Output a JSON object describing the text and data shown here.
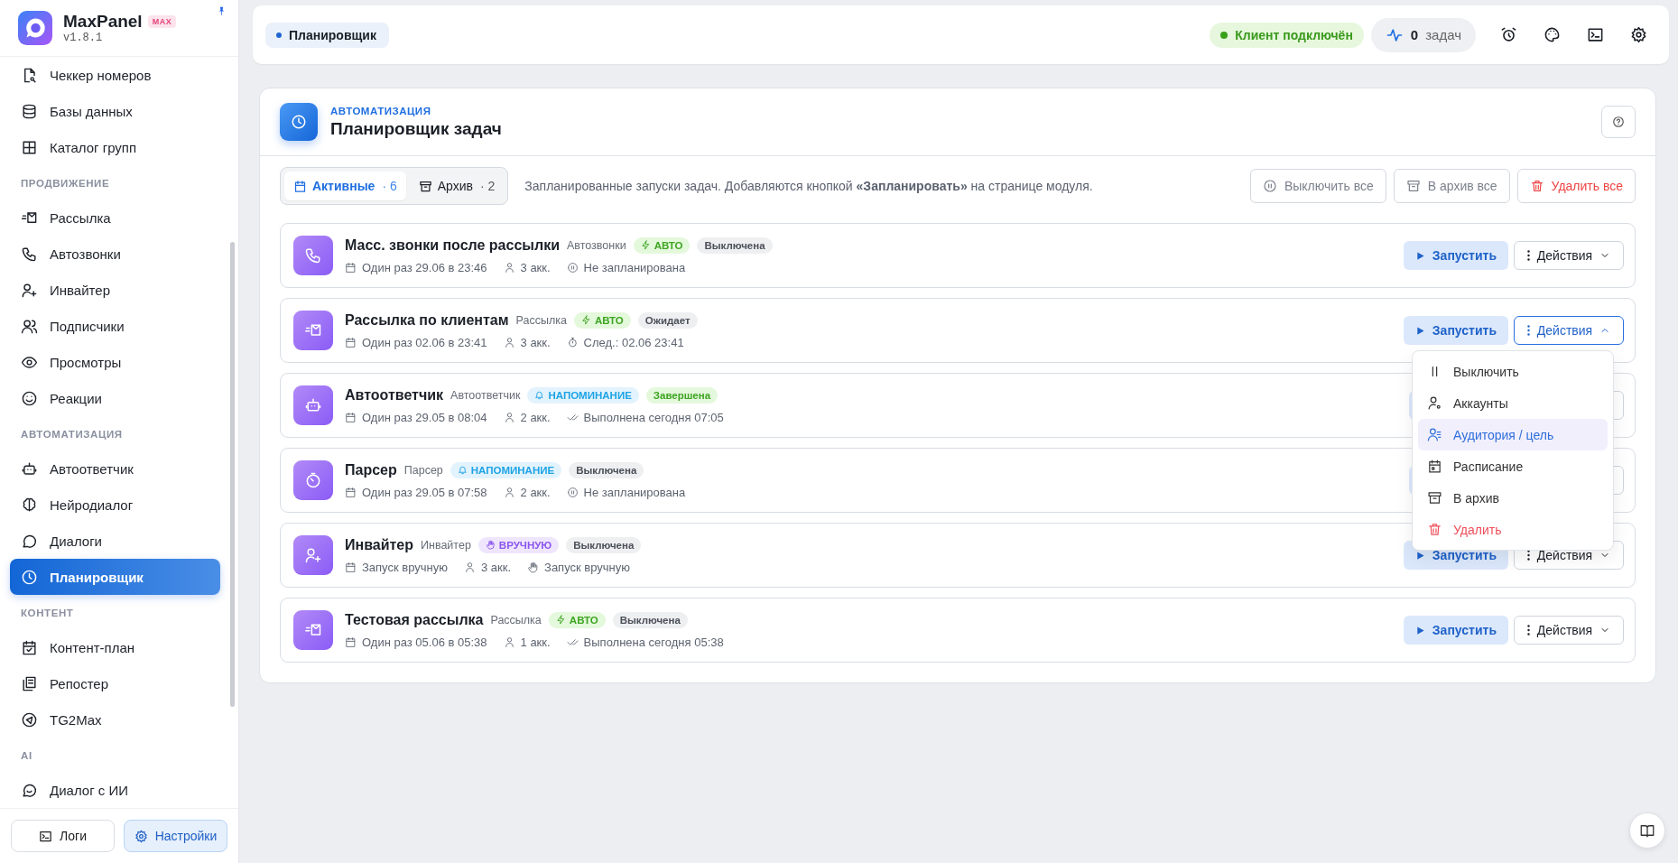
{
  "sidebar": {
    "logo": {
      "name": "MaxPanel",
      "badge": "MAX",
      "version": "v1.8.1"
    },
    "sections": [
      {
        "items": [
          {
            "label": "Чеккер номеров",
            "kind": "checker",
            "selected": false
          },
          {
            "label": "Базы данных",
            "kind": "database",
            "selected": false
          },
          {
            "label": "Каталог групп",
            "kind": "catalog",
            "selected": false
          }
        ]
      },
      {
        "title": "ПРОДВИЖЕНИЕ",
        "items": [
          {
            "label": "Рассылка",
            "kind": "mailing",
            "selected": false
          },
          {
            "label": "Автозвонки",
            "kind": "calls",
            "selected": false
          },
          {
            "label": "Инвайтер",
            "kind": "inviter",
            "selected": false
          },
          {
            "label": "Подписчики",
            "kind": "subscribers",
            "selected": false
          },
          {
            "label": "Просмотры",
            "kind": "views",
            "selected": false
          },
          {
            "label": "Реакции",
            "kind": "reactions",
            "selected": false
          }
        ]
      },
      {
        "title": "АВТОМАТИЗАЦИЯ",
        "items": [
          {
            "label": "Автоответчик",
            "kind": "autoresponder",
            "selected": false
          },
          {
            "label": "Нейродиалог",
            "kind": "neuro",
            "selected": false
          },
          {
            "label": "Диалоги",
            "kind": "dialogs",
            "selected": false
          },
          {
            "label": "Планировщик",
            "kind": "scheduler",
            "selected": true
          }
        ]
      },
      {
        "title": "КОНТЕНТ",
        "items": [
          {
            "label": "Контент-план",
            "kind": "content-plan",
            "selected": false
          },
          {
            "label": "Репостер",
            "kind": "reposter",
            "selected": false
          },
          {
            "label": "TG2Max",
            "kind": "telegram",
            "selected": false
          }
        ]
      },
      {
        "title": "AI",
        "items": [
          {
            "label": "Диалог с ИИ",
            "kind": "ai-chat",
            "selected": false
          }
        ]
      }
    ],
    "footer": [
      {
        "label": "Логи",
        "kind": "logs",
        "selected": false
      },
      {
        "label": "Настройки",
        "kind": "settings",
        "selected": true
      }
    ]
  },
  "header": {
    "breadcrumb": "Планировщик",
    "client_status": {
      "label": "Клиент подключён",
      "connected": true
    },
    "tasks_counter": {
      "count": "0",
      "label": "задач"
    }
  },
  "page": {
    "eyebrow": "АВТОМАТИЗАЦИЯ",
    "title": "Планировщик задач",
    "tabs": [
      {
        "label": "Активные",
        "count": "· 6",
        "selected": true
      },
      {
        "label": "Архив",
        "count": "· 2",
        "selected": false
      }
    ],
    "description": "Запланированные запуски задач. Добавляются кнопкой **«Запланировать»** на странице модуля.",
    "bulk_actions": [
      {
        "label": "Выключить все",
        "kind": "disable"
      },
      {
        "label": "В архив все",
        "kind": "archive"
      },
      {
        "label": "Удалить все",
        "kind": "delete"
      }
    ],
    "tasks": [
      {
        "kind": "calls",
        "title": "Масс. звонки после рассылки",
        "module": "Автозвонки",
        "mode": {
          "label": "АВТО",
          "kind": "auto"
        },
        "status": {
          "label": "Выключена",
          "kind": "off"
        },
        "schedule": "Один раз 29.06 в 23:46",
        "accounts": "3 акк.",
        "state": {
          "label": "Не запланирована",
          "kind": "not-scheduled"
        },
        "run_label": "Запустить",
        "actions_label": "Действия",
        "expanded": false
      },
      {
        "kind": "mailing",
        "title": "Рассылка по клиентам",
        "module": "Рассылка",
        "mode": {
          "label": "АВТО",
          "kind": "auto"
        },
        "status": {
          "label": "Ожидает",
          "kind": "waiting"
        },
        "schedule": "Один раз 02.06 в 23:41",
        "accounts": "3 акк.",
        "state": {
          "label": "След.: 02.06 23:41",
          "kind": "next"
        },
        "run_label": "Запустить",
        "actions_label": "Действия",
        "expanded": true,
        "menu": [
          {
            "label": "Выключить",
            "kind": "disable",
            "selected": false
          },
          {
            "label": "Аккаунты",
            "kind": "accounts",
            "selected": false
          },
          {
            "label": "Аудитория / цель",
            "kind": "audience",
            "selected": true
          },
          {
            "label": "Расписание",
            "kind": "schedule",
            "selected": false
          },
          {
            "label": "В архив",
            "kind": "archive",
            "selected": false
          },
          {
            "label": "Удалить",
            "kind": "delete",
            "selected": false
          }
        ]
      },
      {
        "kind": "autoresponder",
        "title": "Автоответчик",
        "module": "Автоответчик",
        "mode": {
          "label": "НАПОМИНАНИЕ",
          "kind": "reminder"
        },
        "status": {
          "label": "Завершена",
          "kind": "done"
        },
        "schedule": "Один раз 29.05 в 08:04",
        "accounts": "2 акк.",
        "state": {
          "label": "Выполнена сегодня 07:05",
          "kind": "done"
        }
      },
      {
        "kind": "parser",
        "title": "Парсер",
        "module": "Парсер",
        "mode": {
          "label": "НАПОМИНАНИЕ",
          "kind": "reminder"
        },
        "status": {
          "label": "Выключена",
          "kind": "off"
        },
        "schedule": "Один раз 29.05 в 07:58",
        "accounts": "2 акк.",
        "state": {
          "label": "Не запланирована",
          "kind": "not-scheduled"
        }
      },
      {
        "kind": "inviter",
        "title": "Инвайтер",
        "module": "Инвайтер",
        "mode": {
          "label": "ВРУЧНУЮ",
          "kind": "manual"
        },
        "status": {
          "label": "Выключена",
          "kind": "off"
        },
        "schedule": "Запуск вручную",
        "accounts": "3 акк.",
        "state": {
          "label": "Запуск вручную",
          "kind": "manual"
        },
        "run_label": "Запустить",
        "actions_label": "Действия",
        "expanded": false
      },
      {
        "kind": "mailing",
        "title": "Тестовая рассылка",
        "module": "Рассылка",
        "mode": {
          "label": "АВТО",
          "kind": "auto"
        },
        "status": {
          "label": "Выключена",
          "kind": "off"
        },
        "schedule": "Один раз 05.06 в 05:38",
        "accounts": "1 акк.",
        "state": {
          "label": "Выполнена сегодня 05:38",
          "kind": "done"
        },
        "run_label": "Запустить",
        "actions_label": "Действия",
        "expanded": false
      }
    ]
  }
}
